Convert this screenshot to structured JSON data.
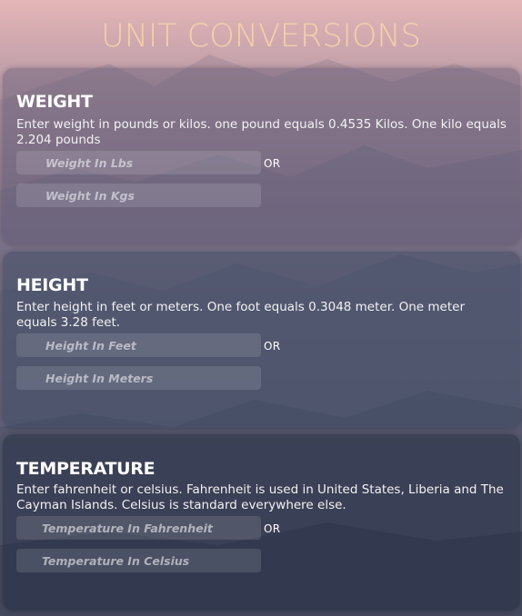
{
  "page": {
    "title": "UNIT CONVERSIONS"
  },
  "sections": {
    "weight": {
      "heading": "WEIGHT",
      "description": "Enter weight in pounds or kilos. one pound equals 0.4535 Kilos. One kilo equals 2.204 pounds",
      "input_primary": {
        "placeholder": "Weight In Lbs",
        "value": ""
      },
      "or_label": "OR",
      "input_secondary": {
        "placeholder": "Weight In Kgs",
        "value": ""
      }
    },
    "height": {
      "heading": "HEIGHT",
      "description": "Enter height in feet or meters. One foot equals 0.3048 meter. One meter equals 3.28 feet.",
      "input_primary": {
        "placeholder": "Height In Feet",
        "value": ""
      },
      "or_label": "OR",
      "input_secondary": {
        "placeholder": "Height In Meters",
        "value": ""
      }
    },
    "temperature": {
      "heading": "TEMPERATURE",
      "description": "Enter fahrenheit or celsius. Fahrenheit is used in United States, Liberia and The Cayman Islands. Celsius is standard everywhere else.",
      "input_primary": {
        "placeholder": "Temperature In Fahrenheit",
        "value": ""
      },
      "or_label": "OR",
      "input_secondary": {
        "placeholder": "Temperature In Celsius",
        "value": ""
      }
    }
  }
}
